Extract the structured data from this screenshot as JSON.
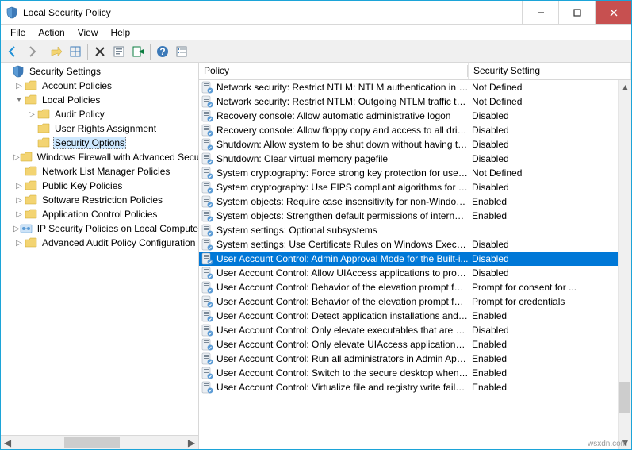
{
  "window": {
    "title": "Local Security Policy"
  },
  "menu": {
    "file": "File",
    "action": "Action",
    "view": "View",
    "help": "Help"
  },
  "tree": {
    "root": "Security Settings",
    "nodes": [
      {
        "label": "Account Policies",
        "indent": 1,
        "expander": "▷",
        "icon": "folder"
      },
      {
        "label": "Local Policies",
        "indent": 1,
        "expander": "⯆",
        "icon": "folder"
      },
      {
        "label": "Audit Policy",
        "indent": 2,
        "expander": "▷",
        "icon": "folder"
      },
      {
        "label": "User Rights Assignment",
        "indent": 2,
        "expander": "",
        "icon": "folder"
      },
      {
        "label": "Security Options",
        "indent": 2,
        "expander": "",
        "icon": "folder",
        "selected": true
      },
      {
        "label": "Windows Firewall with Advanced Secu",
        "indent": 1,
        "expander": "▷",
        "icon": "folder"
      },
      {
        "label": "Network List Manager Policies",
        "indent": 1,
        "expander": "",
        "icon": "folder"
      },
      {
        "label": "Public Key Policies",
        "indent": 1,
        "expander": "▷",
        "icon": "folder"
      },
      {
        "label": "Software Restriction Policies",
        "indent": 1,
        "expander": "▷",
        "icon": "folder"
      },
      {
        "label": "Application Control Policies",
        "indent": 1,
        "expander": "▷",
        "icon": "folder"
      },
      {
        "label": "IP Security Policies on Local Compute",
        "indent": 1,
        "expander": "▷",
        "icon": "ipsec"
      },
      {
        "label": "Advanced Audit Policy Configuration",
        "indent": 1,
        "expander": "▷",
        "icon": "folder"
      }
    ]
  },
  "list": {
    "columns": {
      "policy": "Policy",
      "setting": "Security Setting"
    },
    "rows": [
      {
        "name": "Network security: Restrict NTLM: NTLM authentication in th...",
        "setting": "Not Defined"
      },
      {
        "name": "Network security: Restrict NTLM: Outgoing NTLM traffic to ...",
        "setting": "Not Defined"
      },
      {
        "name": "Recovery console: Allow automatic administrative logon",
        "setting": "Disabled"
      },
      {
        "name": "Recovery console: Allow floppy copy and access to all drives...",
        "setting": "Disabled"
      },
      {
        "name": "Shutdown: Allow system to be shut down without having to...",
        "setting": "Disabled"
      },
      {
        "name": "Shutdown: Clear virtual memory pagefile",
        "setting": "Disabled"
      },
      {
        "name": "System cryptography: Force strong key protection for user k...",
        "setting": "Not Defined"
      },
      {
        "name": "System cryptography: Use FIPS compliant algorithms for en...",
        "setting": "Disabled"
      },
      {
        "name": "System objects: Require case insensitivity for non-Windows ...",
        "setting": "Enabled"
      },
      {
        "name": "System objects: Strengthen default permissions of internal s...",
        "setting": "Enabled"
      },
      {
        "name": "System settings: Optional subsystems",
        "setting": ""
      },
      {
        "name": "System settings: Use Certificate Rules on Windows Executabl...",
        "setting": "Disabled"
      },
      {
        "name": "User Account Control: Admin Approval Mode for the Built-i...",
        "setting": "Disabled",
        "selected": true
      },
      {
        "name": "User Account Control: Allow UIAccess applications to prom...",
        "setting": "Disabled"
      },
      {
        "name": "User Account Control: Behavior of the elevation prompt for ...",
        "setting": "Prompt for consent for ..."
      },
      {
        "name": "User Account Control: Behavior of the elevation prompt for ...",
        "setting": "Prompt for credentials"
      },
      {
        "name": "User Account Control: Detect application installations and p...",
        "setting": "Enabled"
      },
      {
        "name": "User Account Control: Only elevate executables that are sign...",
        "setting": "Disabled"
      },
      {
        "name": "User Account Control: Only elevate UIAccess applications th...",
        "setting": "Enabled"
      },
      {
        "name": "User Account Control: Run all administrators in Admin Appr...",
        "setting": "Enabled"
      },
      {
        "name": "User Account Control: Switch to the secure desktop when pr...",
        "setting": "Enabled"
      },
      {
        "name": "User Account Control: Virtualize file and registry write failure...",
        "setting": "Enabled"
      }
    ]
  },
  "watermark": "wsxdn.com"
}
